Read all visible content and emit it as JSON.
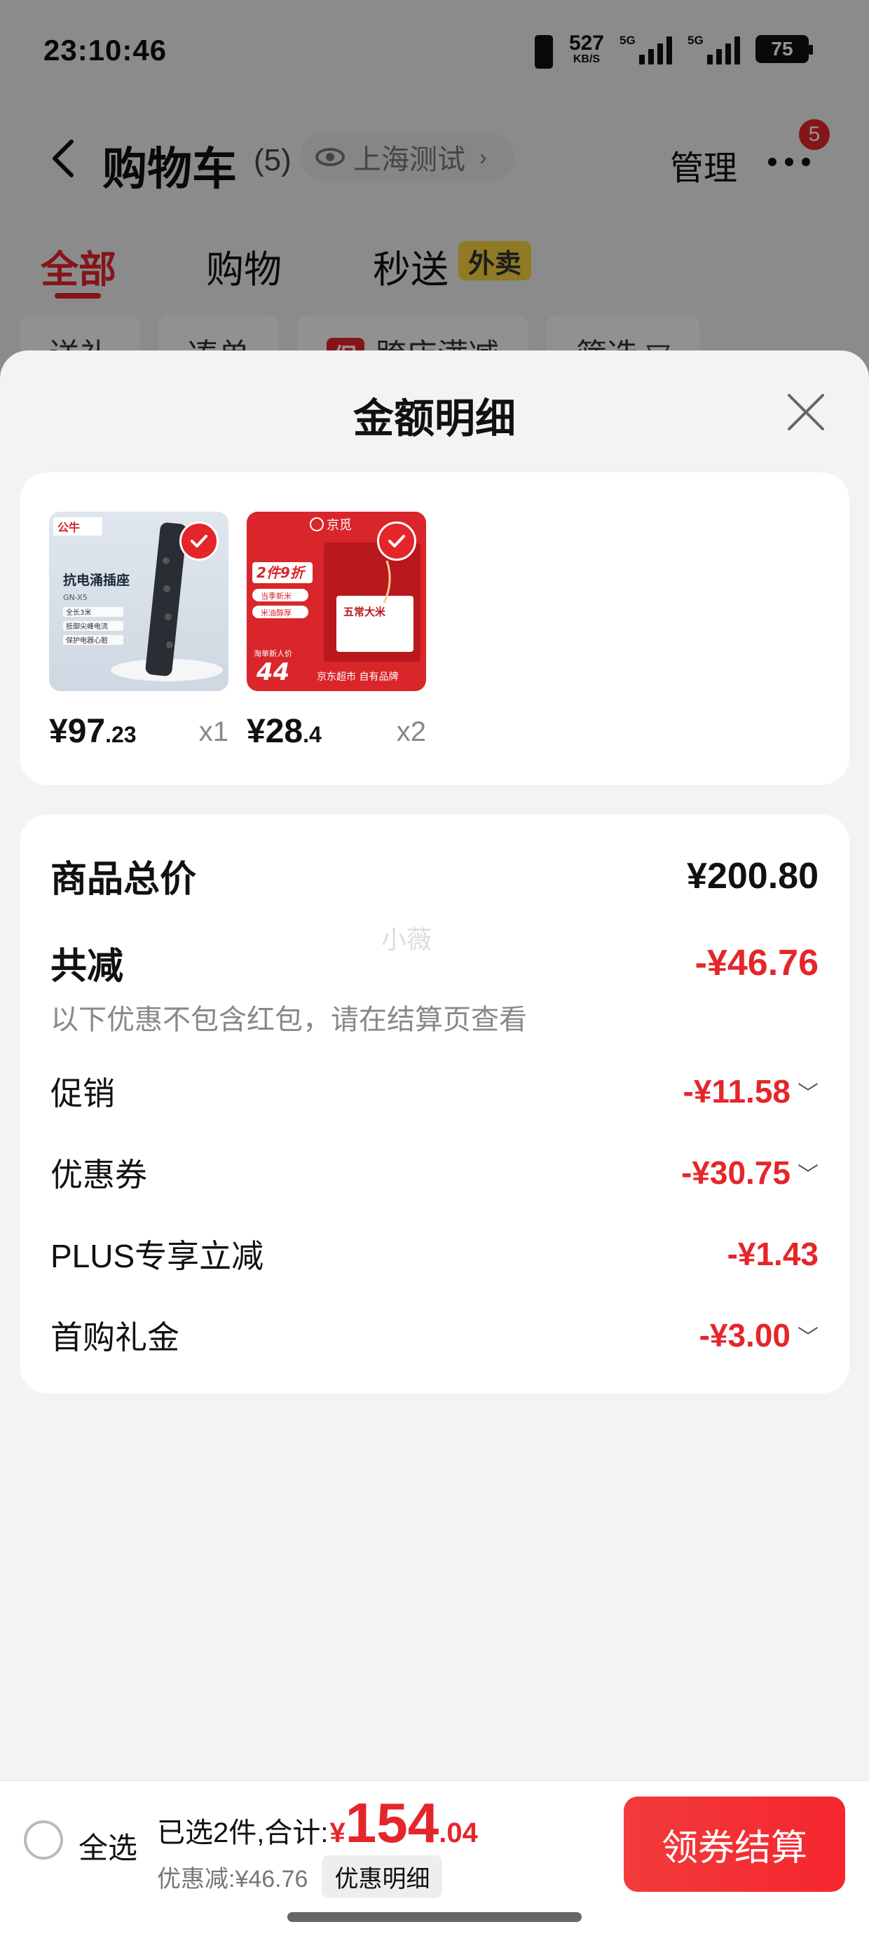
{
  "status_bar": {
    "time": "23:10:46",
    "net_speed": "527",
    "net_unit": "KB/S",
    "sig1_tag": "5G",
    "sig2_tag": "5G",
    "battery": "75"
  },
  "nav": {
    "title": "购物车",
    "count": "(5)",
    "location": "上海测试",
    "manage": "管理",
    "more_badge": "5"
  },
  "tabs": [
    {
      "label": "全部",
      "active": true
    },
    {
      "label": "购物",
      "active": false
    },
    {
      "label": "秒送",
      "active": false
    }
  ],
  "takeout_badge": "外卖",
  "filter_chips": {
    "gift": "送礼",
    "bundle": "凑单",
    "promo_tag": "促",
    "cross_store": "跨店满减",
    "filter": "筛选"
  },
  "sheet": {
    "title": "金额明细",
    "products": [
      {
        "name_image_text": "抗电涌插座",
        "price_int": "¥97",
        "price_dec": ".23",
        "qty": "x1"
      },
      {
        "name_image_text": "五常大米",
        "price_int": "¥28",
        "price_dec": ".4",
        "qty": "x2"
      }
    ],
    "product_images": {
      "p1_brand": "公牛",
      "p1_title": "抗电涌插座",
      "p1_model": "GN-X5",
      "p1_lines": [
        "全长3米",
        "抵御尖峰电流",
        "保护电器心脏"
      ],
      "p2_brand": "京觅",
      "p2_promo": "2件9折",
      "p2_tags": [
        "当季新米",
        "米油醇厚"
      ],
      "p2_product": "五常大米",
      "p2_new_user": "淘单新人价",
      "p2_price": "44",
      "p2_footer": "京东超市 自有品牌"
    },
    "total_label": "商品总价",
    "total_value": "¥200.80",
    "discount_label": "共减",
    "discount_value": "-¥46.76",
    "watermark": "小薇",
    "note": "以下优惠不包含红包，请在结算页查看",
    "items": [
      {
        "label": "促销",
        "value": "-¥11.58",
        "expandable": true
      },
      {
        "label": "优惠券",
        "value": "-¥30.75",
        "expandable": true
      },
      {
        "label": "PLUS专享立减",
        "value": "-¥1.43",
        "expandable": false
      },
      {
        "label": "首购礼金",
        "value": "-¥3.00",
        "expandable": true
      }
    ]
  },
  "bottom_bar": {
    "select_all": "全选",
    "selected_text": "已选2件,合计:",
    "currency": "¥",
    "total_int": "154",
    "total_dec": ".04",
    "saved_text": "优惠减:¥46.76",
    "detail_button": "优惠明细",
    "checkout_button": "领券结算"
  },
  "colors": {
    "accent_red": "#e4262b",
    "takeout_yellow": "#f8d23f"
  }
}
